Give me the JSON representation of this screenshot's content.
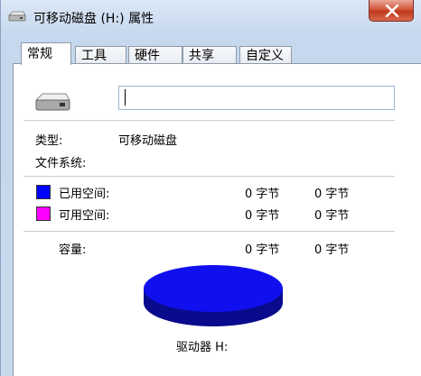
{
  "window": {
    "title": "可移动磁盘 (H:) 属性"
  },
  "tabs": [
    {
      "label": "常规",
      "active": true
    },
    {
      "label": "工具",
      "active": false
    },
    {
      "label": "硬件",
      "active": false
    },
    {
      "label": "共享",
      "active": false
    },
    {
      "label": "自定义",
      "active": false
    }
  ],
  "general": {
    "volume_name_value": "",
    "type_label": "类型:",
    "type_value": "可移动磁盘",
    "filesystem_label": "文件系统:",
    "filesystem_value": "",
    "used_label": "已用空间:",
    "used_bytes": "0 字节",
    "used_size": "0 字节",
    "free_label": "可用空间:",
    "free_bytes": "0 字节",
    "free_size": "0 字节",
    "capacity_label": "容量:",
    "capacity_bytes": "0 字节",
    "capacity_size": "0 字节",
    "drive_label": "驱动器 H:"
  },
  "colors": {
    "used": "#0000ff",
    "free": "#ff00ff",
    "pie_top": "#1010ee",
    "pie_side": "#0a0a8c"
  },
  "icons": {
    "title": "drive-icon",
    "close": "close-icon",
    "drive": "removable-drive-icon"
  }
}
